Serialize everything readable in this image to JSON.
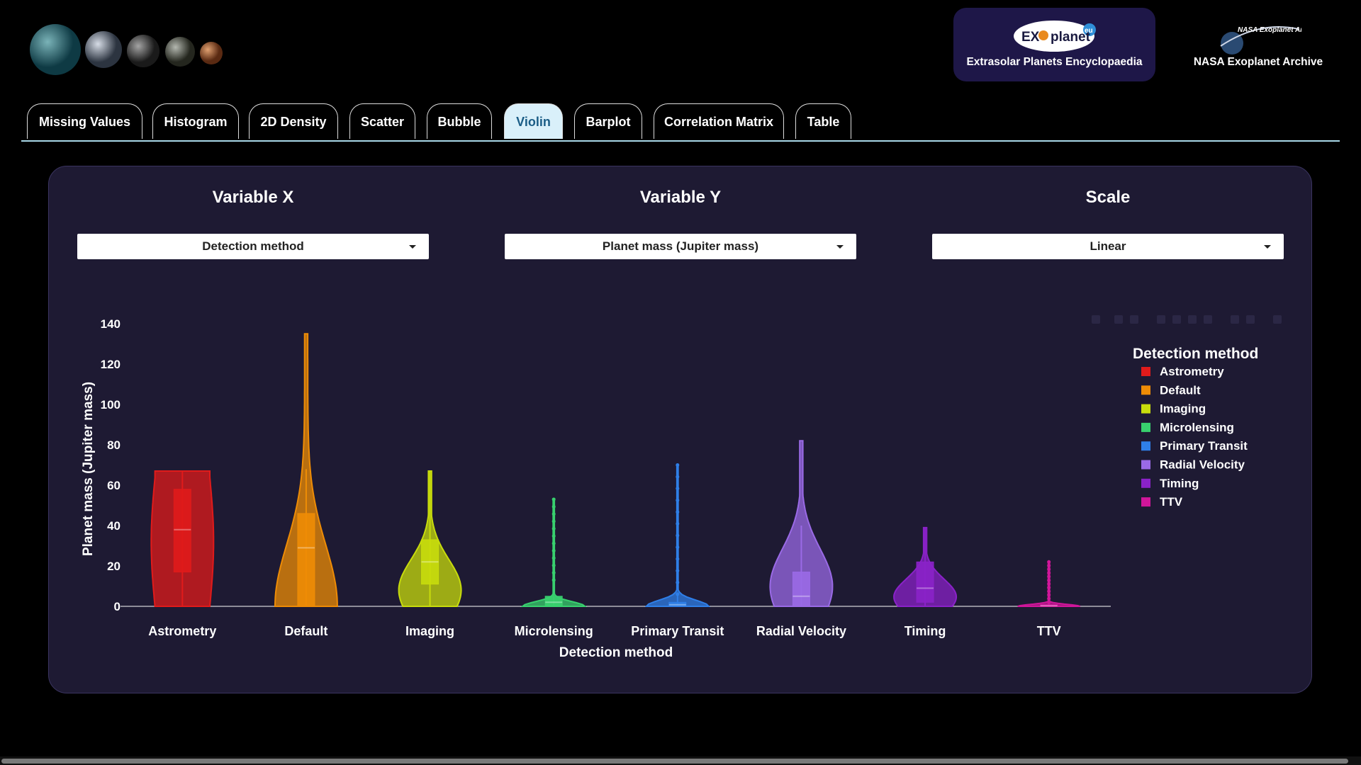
{
  "header": {
    "left_image": "planet-thumbnails",
    "sources": [
      {
        "logo_text": "EX",
        "logo_text2": "planet",
        "logo_badge": "eu",
        "caption": "Extrasolar Planets Encyclopaedia",
        "color": "#1e1748"
      },
      {
        "logo_text": "NASA Exoplanet Archive",
        "caption": "NASA Exoplanet Archive"
      }
    ]
  },
  "tabs": [
    {
      "label": "Missing Values"
    },
    {
      "label": "Histogram"
    },
    {
      "label": "2D Density"
    },
    {
      "label": "Scatter"
    },
    {
      "label": "Bubble"
    },
    {
      "label": "Violin",
      "active": true
    },
    {
      "label": "Barplot"
    },
    {
      "label": "Correlation Matrix"
    },
    {
      "label": "Table"
    }
  ],
  "controls": {
    "variable_x": {
      "label": "Variable X",
      "value": "Detection method"
    },
    "variable_y": {
      "label": "Variable Y",
      "value": "Planet mass (Jupiter mass)"
    },
    "scale": {
      "label": "Scale",
      "value": "Linear"
    }
  },
  "chart_data": {
    "type": "violin",
    "xlabel": "Detection method",
    "ylabel": "Planet mass (Jupiter mass)",
    "ylim": [
      0,
      140
    ],
    "yticks": [
      0,
      20,
      40,
      60,
      80,
      100,
      120,
      140
    ],
    "legend": {
      "title": "Detection method",
      "position": "right"
    },
    "categories": [
      "Astrometry",
      "Default",
      "Imaging",
      "Microlensing",
      "Primary Transit",
      "Radial Velocity",
      "Timing",
      "TTV"
    ],
    "series": [
      {
        "name": "Astrometry",
        "color": "#e01b1b",
        "min": 0,
        "max": 67,
        "q1": 17,
        "median": 38,
        "q3": 58,
        "shape": "flat"
      },
      {
        "name": "Default",
        "color": "#ee8c06",
        "min": 0,
        "max": 135,
        "q1": 0,
        "median": 29,
        "q3": 46,
        "upper_fence": 68,
        "shape": "tall"
      },
      {
        "name": "Imaging",
        "color": "#c8dc0c",
        "min": 0,
        "max": 67,
        "q1": 11,
        "median": 22,
        "q3": 33,
        "shape": "bulb"
      },
      {
        "name": "Microlensing",
        "color": "#38d06e",
        "min": 0,
        "max": 53,
        "q1": 0.5,
        "median": 2,
        "q3": 5,
        "upper_fence": 13,
        "shape": "spike"
      },
      {
        "name": "Primary Transit",
        "color": "#2f7fe8",
        "min": 0,
        "max": 70,
        "q1": 0,
        "median": 0.8,
        "q3": 2,
        "upper_fence": 6,
        "shape": "spike"
      },
      {
        "name": "Radial Velocity",
        "color": "#9a6ae6",
        "min": 0,
        "max": 82,
        "q1": 0,
        "median": 5,
        "q3": 17,
        "upper_fence": 40,
        "shape": "bulb"
      },
      {
        "name": "Timing",
        "color": "#8a22c8",
        "min": 0,
        "max": 39,
        "q1": 2,
        "median": 9,
        "q3": 22,
        "shape": "bulb"
      },
      {
        "name": "TTV",
        "color": "#d0169a",
        "min": 0,
        "max": 22,
        "q1": 0,
        "median": 0.3,
        "q3": 0.8,
        "upper_fence": 2,
        "shape": "spike"
      }
    ]
  }
}
